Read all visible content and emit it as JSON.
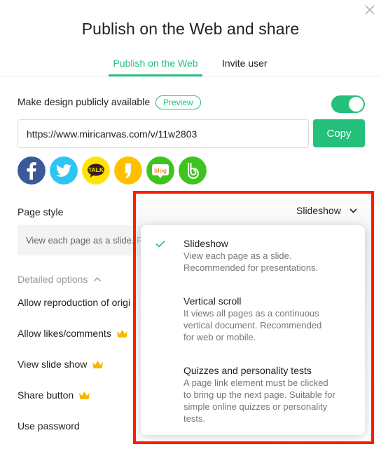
{
  "dialog": {
    "title": "Publish on the Web and share",
    "close_icon": "close-icon"
  },
  "tabs": [
    {
      "label": "Publish on the Web",
      "active": true
    },
    {
      "label": "Invite user",
      "active": false
    }
  ],
  "publish": {
    "public_label": "Make design publicly available",
    "preview_label": "Preview",
    "public_enabled": true,
    "url": "https://www.miricanvas.com/v/11w2803",
    "copy_label": "Copy"
  },
  "share_icons": [
    {
      "name": "facebook-icon",
      "color": "#3b5998"
    },
    {
      "name": "twitter-icon",
      "color": "#2ec5f5"
    },
    {
      "name": "kakaotalk-icon",
      "color": "#fee500"
    },
    {
      "name": "kakaostory-icon",
      "color": "#ffc000"
    },
    {
      "name": "naver-blog-icon",
      "color": "#3ec41f"
    },
    {
      "name": "band-icon",
      "color": "#3ec41f"
    }
  ],
  "page_style": {
    "label": "Page style",
    "selected": "Slideshow",
    "description_truncated": "View each page as a slide. Re",
    "options": [
      {
        "title": "Slideshow",
        "description": [
          "View each page as a slide.",
          "Recommended for presentations."
        ],
        "selected": true
      },
      {
        "title": "Vertical scroll",
        "description": [
          "It views all pages as a continuous",
          "vertical document. Recommended",
          "for web or mobile."
        ],
        "selected": false
      },
      {
        "title": "Quizzes and personality tests",
        "description": [
          "A page link element must be clicked",
          "to bring up the next page. Suitable for",
          "simple online quizzes or personality",
          "tests."
        ],
        "selected": false
      }
    ]
  },
  "detailed_options": {
    "label": "Detailed options",
    "expanded": true,
    "items": [
      {
        "label": "Allow reproduction of origi",
        "premium": false
      },
      {
        "label": "Allow likes/comments",
        "premium": true
      },
      {
        "label": "View slide show",
        "premium": true
      },
      {
        "label": "Share button",
        "premium": true
      },
      {
        "label": "Use password",
        "premium": false
      }
    ]
  },
  "colors": {
    "accent": "#24c07c",
    "highlight_border": "#ff1a00",
    "premium_crown": "#f5b800"
  }
}
